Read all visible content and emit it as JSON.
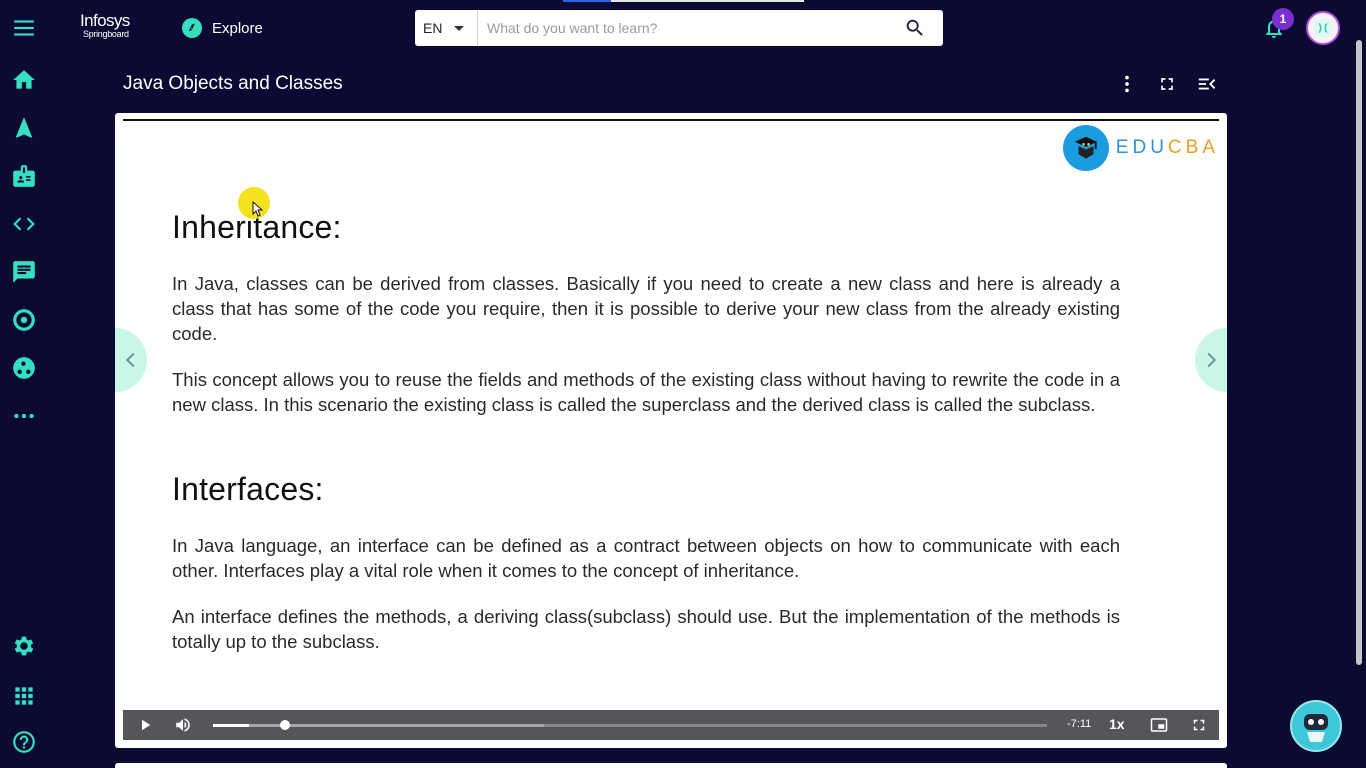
{
  "header": {
    "logo_line1": "Infosys",
    "logo_line2": "Springboard",
    "explore_label": "Explore",
    "language": "EN",
    "search_placeholder": "What do you want to learn?",
    "notification_count": "1"
  },
  "sidebar": {
    "items": [
      {
        "name": "menu-icon"
      },
      {
        "name": "home-icon"
      },
      {
        "name": "navigate-icon"
      },
      {
        "name": "id-badge-icon"
      },
      {
        "name": "code-icon"
      },
      {
        "name": "chat-icon"
      },
      {
        "name": "target-icon"
      },
      {
        "name": "community-icon"
      },
      {
        "name": "more-icon"
      },
      {
        "name": "settings-icon"
      },
      {
        "name": "apps-grid-icon"
      },
      {
        "name": "help-icon"
      }
    ]
  },
  "page": {
    "title": "Java Objects and Classes"
  },
  "slide": {
    "brand": "EDUCBA",
    "brand_edu": "EDU",
    "brand_cba": "CBA",
    "heading1": "Inheritance:",
    "para1": "In Java, classes can be derived from classes. Basically if you need to create a new class and here is already a class that has some of the code you require, then it is possible to derive your new class from the already existing code.",
    "para2": "This concept allows you to reuse the fields and methods of the existing class without having to rewrite the code in a new class. In this scenario the existing class is called the superclass and the derived class is called the subclass.",
    "heading2": "Interfaces:",
    "para3": "In Java language, an interface can be defined as a contract between objects on how to communicate with each other. Interfaces play a vital role when it comes to the concept of inheritance.",
    "para4": "An interface defines the methods, a deriving class(subclass) should use. But the implementation of the methods is totally up to the subclass."
  },
  "player": {
    "time_remaining": "-7:11",
    "speed": "1x",
    "progress_fraction": 0.045,
    "buffered_fraction": 0.37
  },
  "colors": {
    "background": "#0b0a33",
    "accent": "#35dfc0",
    "badge": "#7a2fd0"
  }
}
